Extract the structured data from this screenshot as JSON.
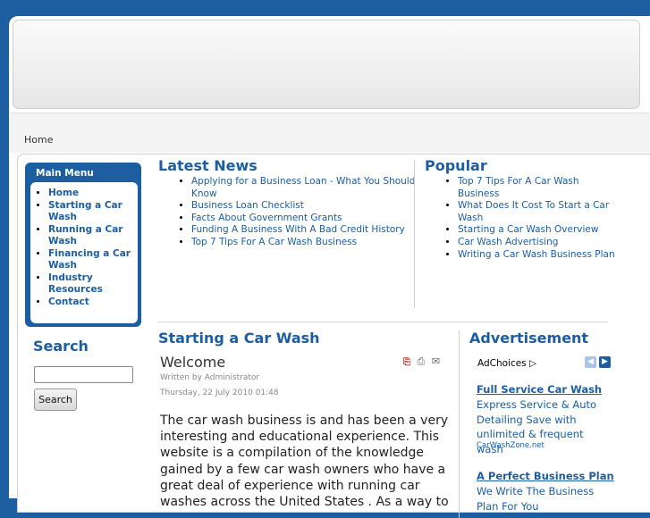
{
  "breadcrumb": {
    "home": "Home"
  },
  "main_menu": {
    "title": "Main Menu",
    "items": [
      "Home",
      "Starting a Car Wash",
      "Running a Car Wash",
      "Financing a Car Wash",
      "Industry Resources",
      "Contact"
    ]
  },
  "search": {
    "title": "Search",
    "value": "",
    "button": "Search"
  },
  "latest_news": {
    "title": "Latest News",
    "items": [
      "Applying for a Business Loan - What You Should Know",
      "Business Loan Checklist",
      "Facts About Government Grants",
      "Funding A Business With A Bad Credit History",
      "Top 7 Tips For A Car Wash Business"
    ]
  },
  "popular": {
    "title": "Popular",
    "items": [
      "Top 7 Tips For A Car Wash Business",
      "What Does It Cost To Start a Car Wash",
      "Starting a Car Wash Overview",
      "Car Wash Advertising",
      "Writing a Car Wash Business Plan"
    ]
  },
  "article": {
    "section_title": "Starting a Car Wash",
    "title": "Welcome",
    "author": "Written by Administrator",
    "date": "Thursday, 22 July 2010 01:48",
    "body": "The car wash business is and has been a very interesting and educational experience. This website is a compilation of the knowledge gained by a few car wash owners who have a great deal of experience with running car washes across the United States . As a way to",
    "icons": [
      "pdf-icon",
      "print-icon",
      "email-icon"
    ]
  },
  "advertisement": {
    "title": "Advertisement",
    "adchoices": "AdChoices",
    "ads": [
      {
        "headline": "Full Service Car Wash",
        "text": "Express Service & Auto Detailing Save with unlimited & frequent wash",
        "url": "CarWashZone.net"
      },
      {
        "headline": "A Perfect Business Plan",
        "text": "We Write The Business Plan For You"
      }
    ]
  },
  "colors": {
    "brand_blue": "#1d5ea0"
  }
}
